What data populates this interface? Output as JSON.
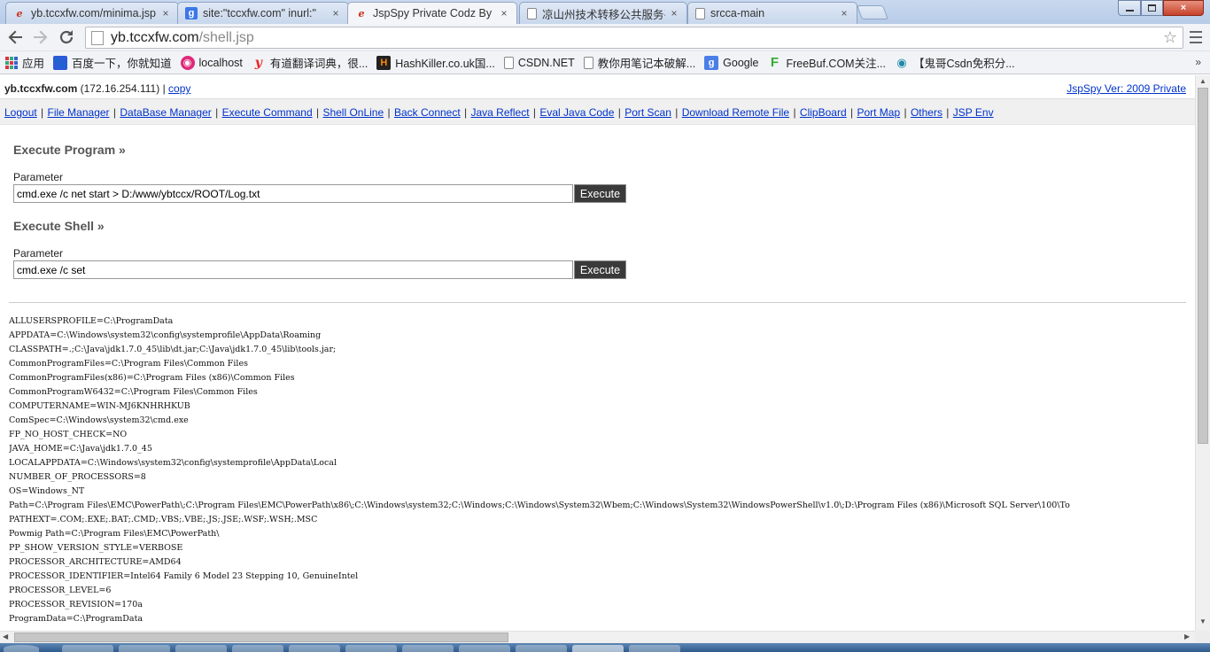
{
  "browser": {
    "tabs": [
      {
        "title": "yb.tccxfw.com/minima.jsp",
        "icon": "ie-e-icon",
        "active": false
      },
      {
        "title": "site:\"tccxfw.com\" inurl:\"",
        "icon": "google-icon",
        "active": false
      },
      {
        "title": "JspSpy Private Codz By",
        "icon": "ie-e-icon",
        "active": true
      },
      {
        "title": "凉山州技术转移公共服务平",
        "icon": "page-icon",
        "active": false
      },
      {
        "title": "srcca-main",
        "icon": "page-icon",
        "active": false
      }
    ],
    "close_glyph": "×",
    "url_host": "yb.tccxfw.com",
    "url_path": "/shell.jsp",
    "bookmarks": [
      {
        "label": "应用",
        "icon": "apps-icon"
      },
      {
        "label": "百度一下，你就知道",
        "icon": "baidu-icon"
      },
      {
        "label": "localhost",
        "icon": "localhost-icon"
      },
      {
        "label": "有道翻译词典，很...",
        "icon": "youdao-icon"
      },
      {
        "label": "HashKiller.co.uk国...",
        "icon": "hashkiller-icon"
      },
      {
        "label": "CSDN.NET",
        "icon": "page-icon"
      },
      {
        "label": "教你用笔记本破解...",
        "icon": "page-icon"
      },
      {
        "label": "Google",
        "icon": "google-icon"
      },
      {
        "label": "FreeBuf.COM关注...",
        "icon": "freebuf-icon"
      },
      {
        "label": "【鬼哥Csdn免积分...",
        "icon": "ghost-icon"
      }
    ],
    "bookmarks_more": "»"
  },
  "page": {
    "host": "yb.tccxfw.com",
    "ip": "(172.16.254.111)",
    "separator": "|",
    "copy_link": "copy",
    "version_link": "JspSpy Ver: 2009 Private",
    "nav_links": [
      "Logout",
      "File Manager",
      "DataBase Manager",
      "Execute Command",
      "Shell OnLine",
      "Back Connect",
      "Java Reflect",
      "Eval Java Code",
      "Port Scan",
      "Download Remote File",
      "ClipBoard",
      "Port Map",
      "Others",
      "JSP Env"
    ],
    "execute_program": {
      "title": "Execute Program »",
      "param_label": "Parameter",
      "value": "cmd.exe /c net start > D:/www/ybtccx/ROOT/Log.txt",
      "button": "Execute"
    },
    "execute_shell": {
      "title": "Execute Shell »",
      "param_label": "Parameter",
      "value": "cmd.exe /c set",
      "button": "Execute"
    },
    "output_lines": [
      "ALLUSERSPROFILE=C:\\ProgramData",
      "APPDATA=C:\\Windows\\system32\\config\\systemprofile\\AppData\\Roaming",
      "CLASSPATH=.;C:\\Java\\jdk1.7.0_45\\lib\\dt.jar;C:\\Java\\jdk1.7.0_45\\lib\\tools.jar;",
      "CommonProgramFiles=C:\\Program Files\\Common Files",
      "CommonProgramFiles(x86)=C:\\Program Files (x86)\\Common Files",
      "CommonProgramW6432=C:\\Program Files\\Common Files",
      "COMPUTERNAME=WIN-MJ6KNHRHKUB",
      "ComSpec=C:\\Windows\\system32\\cmd.exe",
      "FP_NO_HOST_CHECK=NO",
      "JAVA_HOME=C:\\Java\\jdk1.7.0_45",
      "LOCALAPPDATA=C:\\Windows\\system32\\config\\systemprofile\\AppData\\Local",
      "NUMBER_OF_PROCESSORS=8",
      "OS=Windows_NT",
      "Path=C:\\Program Files\\EMC\\PowerPath\\;C:\\Program Files\\EMC\\PowerPath\\x86\\;C:\\Windows\\system32;C:\\Windows;C:\\Windows\\System32\\Wbem;C:\\Windows\\System32\\WindowsPowerShell\\v1.0\\;D:\\Program Files (x86)\\Microsoft SQL Server\\100\\To",
      "PATHEXT=.COM;.EXE;.BAT;.CMD;.VBS;.VBE;.JS;.JSE;.WSF;.WSH;.MSC",
      "Powmig Path=C:\\Program Files\\EMC\\PowerPath\\",
      "PP_SHOW_VERSION_STYLE=VERBOSE",
      "PROCESSOR_ARCHITECTURE=AMD64",
      "PROCESSOR_IDENTIFIER=Intel64 Family 6 Model 23 Stepping 10, GenuineIntel",
      "PROCESSOR_LEVEL=6",
      "PROCESSOR_REVISION=170a",
      "ProgramData=C:\\ProgramData"
    ]
  }
}
